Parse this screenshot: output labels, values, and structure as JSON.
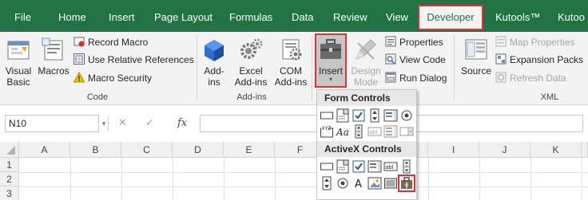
{
  "ribbon_tabs": [
    "File",
    "Home",
    "Insert",
    "Page Layout",
    "Formulas",
    "Data",
    "Review",
    "View",
    "Developer",
    "Kutools™",
    "Kutoo"
  ],
  "active_tab": "Developer",
  "code_group": {
    "label": "Code",
    "visual_basic": "Visual\nBasic",
    "macros": "Macros",
    "record_macro": "Record Macro",
    "use_relative_references": "Use Relative References",
    "macro_security": "Macro Security"
  },
  "addins_group": {
    "label": "Add-ins",
    "addins": "Add-\nins",
    "excel_addins": "Excel\nAdd-ins",
    "com_addins": "COM\nAdd-ins"
  },
  "controls_group": {
    "insert": "Insert",
    "design_mode": "Design\nMode",
    "properties": "Properties",
    "view_code": "View Code",
    "run_dialog": "Run Dialog"
  },
  "xml_group": {
    "label": "XML",
    "source": "Source",
    "map_properties": "Map Properties",
    "expansion_packs": "Expansion Packs",
    "refresh_data": "Refresh Data"
  },
  "formula_bar": {
    "name_box": "N10",
    "fx": "fx",
    "cancel_icon": "✕",
    "enter_icon": "✓"
  },
  "columns": [
    "A",
    "B",
    "C",
    "D",
    "E",
    "F",
    "G",
    "H",
    "I",
    "J",
    "K"
  ],
  "rows": [
    "1",
    "2",
    "3"
  ],
  "insert_panel": {
    "form_controls_title": "Form Controls",
    "activex_controls_title": "ActiveX Controls",
    "form_controls": [
      "button",
      "combo-box",
      "check-box",
      "spin-button",
      "list-box",
      "option-button",
      "group-box",
      "label",
      "scroll-bar",
      "text-field",
      "combo-list-edit",
      "combo-drop-down-edit"
    ],
    "activex_controls": [
      "command-button",
      "combo-box",
      "check-box",
      "text-box",
      "scroll-bar",
      "list-box",
      "option-button",
      "label",
      "image",
      "toggle-button",
      "more-controls"
    ]
  },
  "colors": {
    "ribbon_green": "#217346",
    "highlight_red": "#e0302f",
    "ribbon_bg": "#f3f3f3"
  }
}
